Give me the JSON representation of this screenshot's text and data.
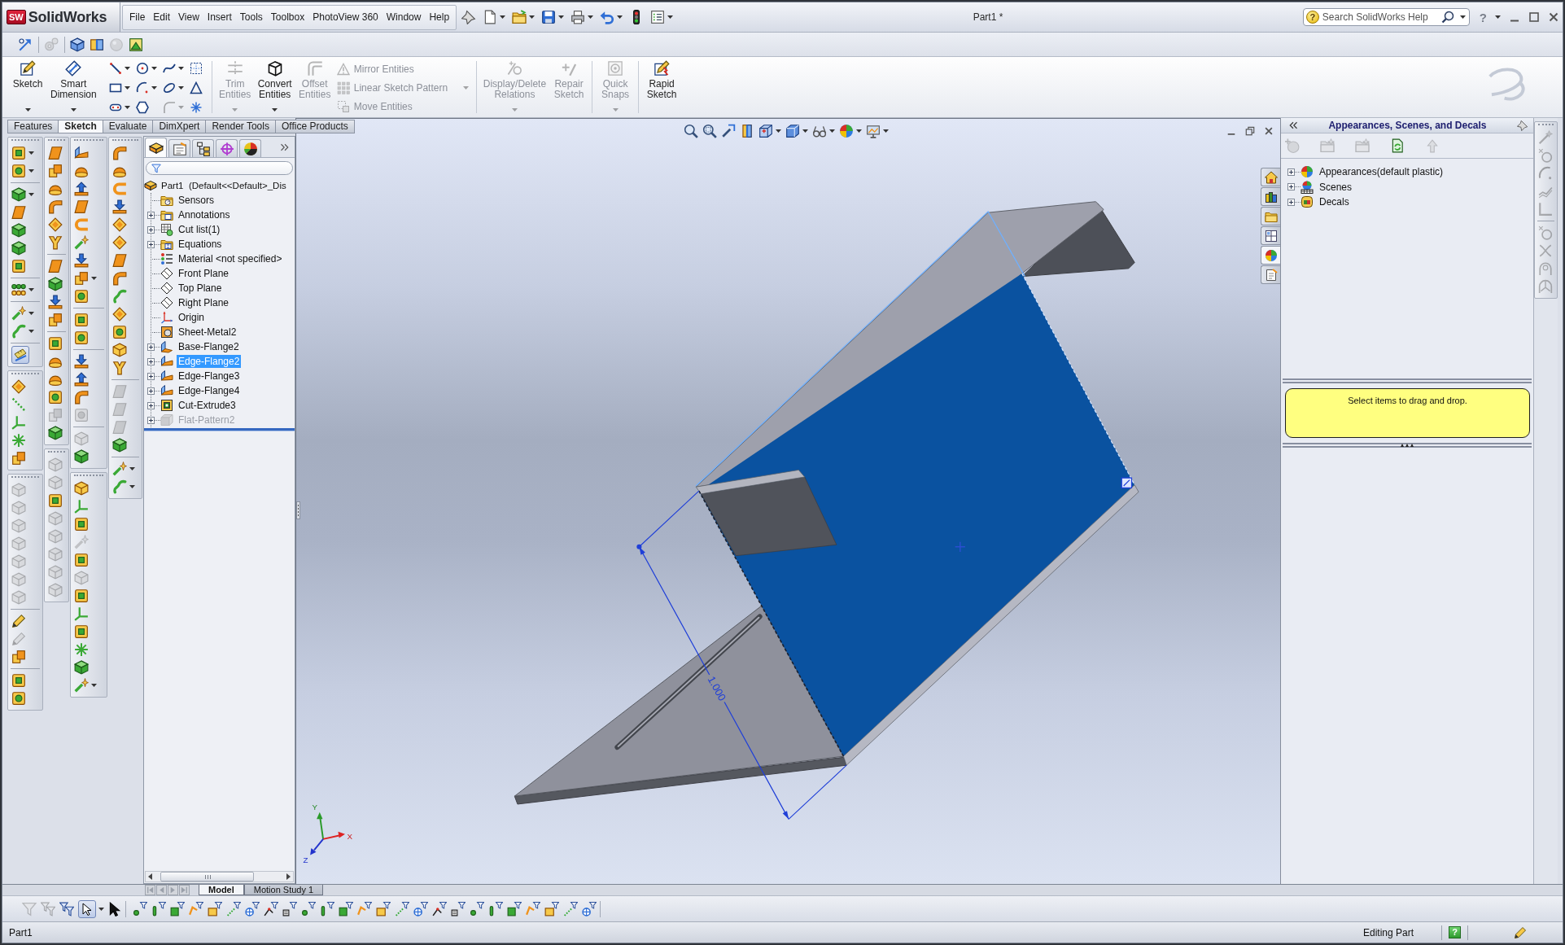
{
  "title_bar": {
    "logo_mark": "SW",
    "app_name": "SolidWorks",
    "menu": [
      "File",
      "Edit",
      "View",
      "Insert",
      "Tools",
      "Toolbox",
      "PhotoView 360",
      "Window",
      "Help"
    ],
    "quick_access": [
      {
        "kind": "pin",
        "dropdown": false
      },
      {
        "kind": "new",
        "dropdown": true
      },
      {
        "kind": "open",
        "dropdown": true
      },
      {
        "kind": "save",
        "dropdown": true
      },
      {
        "kind": "print",
        "dropdown": true
      },
      {
        "kind": "undo",
        "dropdown": true
      },
      {
        "kind": "rebuild",
        "dropdown": false
      },
      {
        "kind": "options",
        "dropdown": true
      }
    ],
    "document_title": "Part1 *",
    "search": {
      "badge": "?",
      "placeholder": "Search SolidWorks Help"
    },
    "help": "?"
  },
  "standard_toolbar": [
    [
      {
        "kind": "selectsketch",
        "disabled": false
      }
    ],
    [
      {
        "kind": "gears",
        "disabled": true
      }
    ],
    [
      {
        "kind": "bluecube",
        "disabled": false
      },
      {
        "kind": "section",
        "disabled": false
      },
      {
        "kind": "sphere",
        "disabled": true
      },
      {
        "kind": "scene",
        "disabled": false
      }
    ]
  ],
  "command_manager": [
    [
      {
        "kind": "large",
        "buttons": [
          {
            "kind": "sketch",
            "label": "Sketch",
            "disabled": false,
            "dropdown": true
          },
          {
            "kind": "smartdim",
            "label": "Smart Dimension",
            "disabled": false,
            "dropdown": true
          }
        ]
      },
      {
        "kind": "grid",
        "buttons": [
          {
            "kind": "sline",
            "disabled": false,
            "dropdown": true
          },
          {
            "kind": "scircle",
            "disabled": false,
            "dropdown": true
          },
          {
            "kind": "sspline",
            "disabled": false,
            "dropdown": true
          },
          {
            "kind": "sgrid",
            "disabled": false,
            "dropdown": false
          },
          {
            "kind": "srect",
            "disabled": false,
            "dropdown": true
          },
          {
            "kind": "sarc",
            "disabled": false,
            "dropdown": true
          },
          {
            "kind": "sellipse",
            "disabled": false,
            "dropdown": true
          },
          {
            "kind": "stext",
            "disabled": false,
            "dropdown": false
          },
          {
            "kind": "sslot",
            "disabled": false,
            "dropdown": true
          },
          {
            "kind": "spoly",
            "disabled": false,
            "dropdown": false
          },
          {
            "kind": "sfillet",
            "disabled": true,
            "dropdown": true
          },
          {
            "kind": "spoint",
            "disabled": false,
            "dropdown": false
          }
        ]
      }
    ],
    [
      {
        "kind": "large",
        "buttons": [
          {
            "kind": "trim",
            "label": "Trim Entities",
            "disabled": true,
            "dropdown": true
          },
          {
            "kind": "convert",
            "label": "Convert Entities",
            "disabled": false,
            "dropdown": true
          },
          {
            "kind": "offset",
            "label": "Offset Entities",
            "disabled": true,
            "dropdown": false
          }
        ]
      },
      {
        "kind": "list",
        "buttons": [
          {
            "kind": "mirror",
            "label": "Mirror Entities",
            "disabled": true,
            "dropdown": false
          },
          {
            "kind": "lpattern",
            "label": "Linear Sketch Pattern",
            "disabled": true,
            "dropdown": true
          },
          {
            "kind": "move",
            "label": "Move Entities",
            "disabled": true,
            "dropdown": false
          }
        ]
      }
    ],
    [
      {
        "kind": "large",
        "buttons": [
          {
            "kind": "relations",
            "label": "Display/Delete Relations",
            "disabled": true,
            "dropdown": true
          },
          {
            "kind": "repair",
            "label": "Repair Sketch",
            "disabled": true,
            "dropdown": false
          }
        ]
      }
    ],
    [
      {
        "kind": "large",
        "buttons": [
          {
            "kind": "snaps",
            "label": "Quick Snaps",
            "disabled": true,
            "dropdown": true
          }
        ]
      }
    ],
    [
      {
        "kind": "large",
        "buttons": [
          {
            "kind": "rapid",
            "label": "Rapid Sketch",
            "disabled": false,
            "dropdown": false
          }
        ]
      }
    ]
  ],
  "tabs": [
    {
      "label": "Features",
      "selected": false
    },
    {
      "label": "Sketch",
      "selected": true
    },
    {
      "label": "Evaluate",
      "selected": false
    },
    {
      "label": "DimXpert",
      "selected": false
    },
    {
      "label": "Render Tools",
      "selected": false
    },
    {
      "label": "Office Products",
      "selected": false
    }
  ],
  "left_toolbars": [
    [
      [
        [
          {
            "kind": "block",
            "disabled": false,
            "dropdown": true,
            "selected": false
          },
          {
            "kind": "ring",
            "disabled": false,
            "dropdown": true,
            "selected": false
          }
        ],
        [
          {
            "kind": "prism",
            "disabled": false,
            "dropdown": true,
            "selected": false
          },
          {
            "kind": "sheet",
            "disabled": false,
            "dropdown": false,
            "selected": false
          },
          {
            "kind": "prism",
            "disabled": false,
            "dropdown": false,
            "selected": false
          },
          {
            "kind": "prism",
            "disabled": false,
            "dropdown": false,
            "selected": false
          },
          {
            "kind": "block",
            "disabled": false,
            "dropdown": false,
            "selected": false
          }
        ],
        [
          {
            "kind": "dots",
            "disabled": false,
            "dropdown": true,
            "selected": false
          }
        ],
        [
          {
            "kind": "sparkle",
            "disabled": false,
            "dropdown": true,
            "selected": false
          },
          {
            "kind": "curve",
            "disabled": false,
            "dropdown": true,
            "selected": false
          }
        ],
        [
          {
            "kind": "ruler",
            "disabled": false,
            "dropdown": false,
            "selected": true
          }
        ]
      ],
      [
        [
          {
            "kind": "diamond",
            "disabled": false,
            "dropdown": false,
            "selected": false
          },
          {
            "kind": "line",
            "disabled": false,
            "dropdown": false,
            "selected": false
          },
          {
            "kind": "axes",
            "disabled": false,
            "dropdown": false,
            "selected": false
          },
          {
            "kind": "star",
            "disabled": false,
            "dropdown": false,
            "selected": false
          },
          {
            "kind": "stack",
            "disabled": false,
            "dropdown": false,
            "selected": false
          }
        ]
      ],
      [
        [
          {
            "kind": "cube",
            "disabled": true,
            "dropdown": false,
            "selected": false
          },
          {
            "kind": "cube",
            "disabled": true,
            "dropdown": false,
            "selected": false
          },
          {
            "kind": "cube",
            "disabled": true,
            "dropdown": false,
            "selected": false
          },
          {
            "kind": "cube",
            "disabled": true,
            "dropdown": false,
            "selected": false
          },
          {
            "kind": "cube",
            "disabled": true,
            "dropdown": false,
            "selected": false
          },
          {
            "kind": "cube",
            "disabled": true,
            "dropdown": false,
            "selected": false
          },
          {
            "kind": "cube",
            "disabled": true,
            "dropdown": false,
            "selected": false
          }
        ],
        [
          {
            "kind": "pencil",
            "disabled": false,
            "dropdown": false,
            "selected": false
          },
          {
            "kind": "pencil",
            "disabled": true,
            "dropdown": false,
            "selected": false
          },
          {
            "kind": "stack",
            "disabled": false,
            "dropdown": false,
            "selected": false
          }
        ],
        [
          {
            "kind": "block",
            "disabled": false,
            "dropdown": false,
            "selected": false
          },
          {
            "kind": "ring",
            "disabled": false,
            "dropdown": false,
            "selected": false
          }
        ]
      ]
    ],
    [
      [
        [
          {
            "kind": "sheet",
            "disabled": false,
            "dropdown": false,
            "selected": false
          },
          {
            "kind": "stack",
            "disabled": false,
            "dropdown": false,
            "selected": false
          },
          {
            "kind": "dome",
            "disabled": false,
            "dropdown": false,
            "selected": false
          },
          {
            "kind": "bend",
            "disabled": false,
            "dropdown": false,
            "selected": false
          },
          {
            "kind": "diamond",
            "disabled": false,
            "dropdown": false,
            "selected": false
          },
          {
            "kind": "fork",
            "disabled": false,
            "dropdown": false,
            "selected": false
          }
        ],
        [
          {
            "kind": "sheet",
            "disabled": false,
            "dropdown": false,
            "selected": false
          },
          {
            "kind": "prism",
            "disabled": false,
            "dropdown": false,
            "selected": false
          },
          {
            "kind": "arrowdown",
            "disabled": false,
            "dropdown": false,
            "selected": false
          },
          {
            "kind": "stack",
            "disabled": false,
            "dropdown": false,
            "selected": false
          }
        ],
        [
          {
            "kind": "block",
            "disabled": false,
            "dropdown": false,
            "selected": false
          },
          {
            "kind": "dome",
            "disabled": false,
            "dropdown": false,
            "selected": false
          },
          {
            "kind": "dome",
            "disabled": false,
            "dropdown": false,
            "selected": false
          },
          {
            "kind": "ring",
            "disabled": false,
            "dropdown": false,
            "selected": false
          },
          {
            "kind": "stack",
            "disabled": true,
            "dropdown": false,
            "selected": false
          },
          {
            "kind": "prism",
            "disabled": false,
            "dropdown": false,
            "selected": false
          }
        ]
      ],
      [
        [
          {
            "kind": "cube",
            "disabled": true,
            "dropdown": false,
            "selected": false
          },
          {
            "kind": "cube",
            "disabled": true,
            "dropdown": false,
            "selected": false
          },
          {
            "kind": "block",
            "disabled": false,
            "dropdown": false,
            "selected": false
          },
          {
            "kind": "cube",
            "disabled": true,
            "dropdown": false,
            "selected": false
          },
          {
            "kind": "cube",
            "disabled": true,
            "dropdown": false,
            "selected": false
          },
          {
            "kind": "cube",
            "disabled": true,
            "dropdown": false,
            "selected": false
          },
          {
            "kind": "cube",
            "disabled": true,
            "dropdown": false,
            "selected": false
          },
          {
            "kind": "cube",
            "disabled": true,
            "dropdown": false,
            "selected": false
          }
        ]
      ]
    ],
    [
      [
        [
          {
            "kind": "flange",
            "disabled": false,
            "dropdown": false,
            "selected": false
          },
          {
            "kind": "dome",
            "disabled": false,
            "dropdown": false,
            "selected": false
          },
          {
            "kind": "arrowup",
            "disabled": false,
            "dropdown": false,
            "selected": false
          },
          {
            "kind": "sheet",
            "disabled": false,
            "dropdown": false,
            "selected": false
          },
          {
            "kind": "hook",
            "disabled": false,
            "dropdown": false,
            "selected": false
          },
          {
            "kind": "sparkle",
            "disabled": false,
            "dropdown": false,
            "selected": false
          },
          {
            "kind": "arrowdown",
            "disabled": false,
            "dropdown": false,
            "selected": false
          },
          {
            "kind": "stack",
            "disabled": false,
            "dropdown": true,
            "selected": false
          },
          {
            "kind": "ring",
            "disabled": false,
            "dropdown": false,
            "selected": false
          }
        ],
        [
          {
            "kind": "block",
            "disabled": false,
            "dropdown": false,
            "selected": false
          },
          {
            "kind": "ring",
            "disabled": false,
            "dropdown": false,
            "selected": false
          }
        ],
        [
          {
            "kind": "arrowdown",
            "disabled": false,
            "dropdown": false,
            "selected": false
          },
          {
            "kind": "arrowup",
            "disabled": false,
            "dropdown": false,
            "selected": false
          },
          {
            "kind": "bend",
            "disabled": false,
            "dropdown": false,
            "selected": false
          },
          {
            "kind": "ring",
            "disabled": true,
            "dropdown": false,
            "selected": false
          }
        ],
        [
          {
            "kind": "cube",
            "disabled": true,
            "dropdown": false,
            "selected": false
          },
          {
            "kind": "prism",
            "disabled": false,
            "dropdown": false,
            "selected": false
          }
        ]
      ],
      [
        [
          {
            "kind": "cube",
            "disabled": false,
            "dropdown": false,
            "selected": false
          },
          {
            "kind": "axes",
            "disabled": false,
            "dropdown": false,
            "selected": false
          },
          {
            "kind": "block",
            "disabled": false,
            "dropdown": false,
            "selected": false
          },
          {
            "kind": "sparkle",
            "disabled": true,
            "dropdown": false,
            "selected": false
          },
          {
            "kind": "block",
            "disabled": false,
            "dropdown": false,
            "selected": false
          },
          {
            "kind": "cube",
            "disabled": true,
            "dropdown": false,
            "selected": false
          },
          {
            "kind": "block",
            "disabled": false,
            "dropdown": false,
            "selected": false
          },
          {
            "kind": "axes",
            "disabled": false,
            "dropdown": false,
            "selected": false
          },
          {
            "kind": "block",
            "disabled": false,
            "dropdown": false,
            "selected": false
          },
          {
            "kind": "star",
            "disabled": false,
            "dropdown": false,
            "selected": false
          },
          {
            "kind": "prism",
            "disabled": false,
            "dropdown": false,
            "selected": false
          },
          {
            "kind": "sparkle",
            "disabled": false,
            "dropdown": true,
            "selected": false
          }
        ]
      ]
    ],
    [
      [
        [
          {
            "kind": "bend",
            "disabled": false,
            "dropdown": false,
            "selected": false
          },
          {
            "kind": "dome",
            "disabled": false,
            "dropdown": false,
            "selected": false
          },
          {
            "kind": "hook",
            "disabled": false,
            "dropdown": false,
            "selected": false
          },
          {
            "kind": "arrowdown",
            "disabled": false,
            "dropdown": false,
            "selected": false
          },
          {
            "kind": "diamond",
            "disabled": false,
            "dropdown": false,
            "selected": false
          },
          {
            "kind": "diamond",
            "disabled": false,
            "dropdown": false,
            "selected": false
          },
          {
            "kind": "sheet",
            "disabled": false,
            "dropdown": false,
            "selected": false
          },
          {
            "kind": "bend",
            "disabled": false,
            "dropdown": false,
            "selected": false
          },
          {
            "kind": "curve",
            "disabled": false,
            "dropdown": false,
            "selected": false
          },
          {
            "kind": "diamond",
            "disabled": false,
            "dropdown": false,
            "selected": false
          },
          {
            "kind": "ring",
            "disabled": false,
            "dropdown": false,
            "selected": false
          },
          {
            "kind": "cube",
            "disabled": false,
            "dropdown": false,
            "selected": false
          },
          {
            "kind": "fork",
            "disabled": false,
            "dropdown": false,
            "selected": false
          }
        ],
        [
          {
            "kind": "sheet",
            "disabled": true,
            "dropdown": false,
            "selected": false
          },
          {
            "kind": "sheet",
            "disabled": true,
            "dropdown": false,
            "selected": false
          },
          {
            "kind": "sheet",
            "disabled": true,
            "dropdown": false,
            "selected": false
          },
          {
            "kind": "prism",
            "disabled": false,
            "dropdown": false,
            "selected": false
          }
        ],
        [
          {
            "kind": "sparkle",
            "disabled": false,
            "dropdown": true,
            "selected": false
          },
          {
            "kind": "curve",
            "disabled": false,
            "dropdown": true,
            "selected": false
          }
        ]
      ]
    ]
  ],
  "feature_manager": {
    "tabs": [
      {
        "kind": "tree",
        "selected": true
      },
      {
        "kind": "property",
        "selected": false
      },
      {
        "kind": "config",
        "selected": false
      },
      {
        "kind": "dimxpert",
        "selected": false
      },
      {
        "kind": "display",
        "selected": false
      }
    ],
    "tree": {
      "label": "Part1  (Default<<Default>_Dis",
      "kind": "part",
      "children": [
        {
          "label": "Sensors",
          "kind": "sensors",
          "expandable": false,
          "selected": false,
          "disabled": false
        },
        {
          "label": "Annotations",
          "kind": "annotations",
          "expandable": true,
          "selected": false,
          "disabled": false
        },
        {
          "label": "Cut list(1)",
          "kind": "cutlist",
          "expandable": true,
          "selected": false,
          "disabled": false
        },
        {
          "label": "Equations",
          "kind": "equations",
          "expandable": true,
          "selected": false,
          "disabled": false
        },
        {
          "label": "Material <not specified>",
          "kind": "material",
          "expandable": false,
          "selected": false,
          "disabled": false
        },
        {
          "label": "Front Plane",
          "kind": "plane",
          "expandable": false,
          "selected": false,
          "disabled": false
        },
        {
          "label": "Top Plane",
          "kind": "plane",
          "expandable": false,
          "selected": false,
          "disabled": false
        },
        {
          "label": "Right Plane",
          "kind": "plane",
          "expandable": false,
          "selected": false,
          "disabled": false
        },
        {
          "label": "Origin",
          "kind": "origin",
          "expandable": false,
          "selected": false,
          "disabled": false
        },
        {
          "label": "Sheet-Metal2",
          "kind": "sheetmetal",
          "expandable": false,
          "selected": false,
          "disabled": false
        },
        {
          "label": "Base-Flange2",
          "kind": "baseflange",
          "expandable": true,
          "selected": false,
          "disabled": false
        },
        {
          "label": "Edge-Flange2",
          "kind": "flange",
          "expandable": true,
          "selected": true,
          "disabled": false
        },
        {
          "label": "Edge-Flange3",
          "kind": "flange",
          "expandable": true,
          "selected": false,
          "disabled": false
        },
        {
          "label": "Edge-Flange4",
          "kind": "flange",
          "expandable": true,
          "selected": false,
          "disabled": false
        },
        {
          "label": "Cut-Extrude3",
          "kind": "cutextrude",
          "expandable": true,
          "selected": false,
          "disabled": false
        },
        {
          "label": "Flat-Pattern2",
          "kind": "flatpattern",
          "expandable": true,
          "selected": false,
          "disabled": true
        }
      ]
    }
  },
  "viewport": {
    "heads_up_toolbar": [
      {
        "kind": "zoomfit",
        "dropdown": false
      },
      {
        "kind": "zoomarea",
        "dropdown": false
      },
      {
        "kind": "prevview",
        "dropdown": false
      },
      {
        "kind": "sectionview",
        "dropdown": false
      },
      {
        "kind": "orientation",
        "dropdown": true
      },
      {
        "kind": "displaystyle",
        "dropdown": true
      },
      {
        "kind": "hideshow",
        "dropdown": true
      },
      {
        "kind": "appearance",
        "dropdown": true
      },
      {
        "kind": "scenemenu",
        "dropdown": true
      }
    ],
    "dimension": "1.000",
    "triad": {
      "x": "X",
      "y": "Y",
      "z": "Z"
    }
  },
  "task_pane": {
    "tabs": [
      {
        "kind": "home",
        "selected": false
      },
      {
        "kind": "library",
        "selected": false
      },
      {
        "kind": "explorer",
        "selected": false
      },
      {
        "kind": "palette",
        "selected": false
      },
      {
        "kind": "appearances",
        "selected": true
      },
      {
        "kind": "properties",
        "selected": false
      }
    ],
    "title": "Appearances, Scenes, and Decals",
    "toolbar": [
      {
        "kind": "add",
        "disabled": true
      },
      {
        "kind": "newfolder",
        "disabled": true
      },
      {
        "kind": "newfolder",
        "disabled": true
      },
      {
        "kind": "refresh",
        "disabled": false
      },
      {
        "kind": "up",
        "disabled": true
      }
    ],
    "tree": [
      {
        "label": "Appearances(default plastic)",
        "kind": "appearances",
        "expandable": true
      },
      {
        "label": "Scenes",
        "kind": "scenes",
        "expandable": true
      },
      {
        "label": "Decals",
        "kind": "decals",
        "expandable": true
      }
    ],
    "hint": "Select items to drag and drop."
  },
  "sketch_toolbar": [
    [
      {
        "kind": "wand",
        "disabled": true
      },
      {
        "kind": "circletip",
        "disabled": true
      },
      {
        "kind": "sarc",
        "disabled": true
      },
      {
        "kind": "zigzag",
        "disabled": true
      },
      {
        "kind": "corner",
        "disabled": true
      }
    ],
    [
      {
        "kind": "circletip",
        "disabled": true
      },
      {
        "kind": "trimx",
        "disabled": true
      },
      {
        "kind": "arch",
        "disabled": true
      },
      {
        "kind": "wheel",
        "disabled": true
      }
    ]
  ],
  "bottom_tabs": [
    {
      "label": "Model",
      "selected": true
    },
    {
      "label": "Motion Study 1",
      "selected": false
    }
  ],
  "selection_filter": [
    [
      {
        "kind": "funnel",
        "disabled": true,
        "selected": false,
        "dropdown": false
      },
      {
        "kind": "funnels",
        "disabled": true,
        "selected": false,
        "dropdown": false
      },
      {
        "kind": "funnels",
        "disabled": false,
        "selected": false,
        "dropdown": false
      },
      {
        "kind": "select",
        "disabled": false,
        "selected": true,
        "dropdown": true
      },
      {
        "kind": "arrow",
        "disabled": false,
        "selected": false,
        "dropdown": false
      }
    ],
    [
      {
        "kind": "shapefilter",
        "disabled": false,
        "selected": false,
        "dropdown": false
      },
      {
        "kind": "shapefilter",
        "disabled": false,
        "selected": false,
        "dropdown": false
      },
      {
        "kind": "shapefilter",
        "disabled": false,
        "selected": false,
        "dropdown": false
      },
      {
        "kind": "shapefilter",
        "disabled": false,
        "selected": false,
        "dropdown": false
      },
      {
        "kind": "shapefilter",
        "disabled": false,
        "selected": false,
        "dropdown": false
      },
      {
        "kind": "shapefilter",
        "disabled": false,
        "selected": false,
        "dropdown": false
      },
      {
        "kind": "shapefilter",
        "disabled": false,
        "selected": false,
        "dropdown": false
      },
      {
        "kind": "shapefilter",
        "disabled": false,
        "selected": false,
        "dropdown": false
      },
      {
        "kind": "shapefilter",
        "disabled": false,
        "selected": false,
        "dropdown": false
      },
      {
        "kind": "shapefilter",
        "disabled": false,
        "selected": false,
        "dropdown": false
      },
      {
        "kind": "shapefilter",
        "disabled": false,
        "selected": false,
        "dropdown": false
      },
      {
        "kind": "shapefilter",
        "disabled": false,
        "selected": false,
        "dropdown": false
      },
      {
        "kind": "shapefilter",
        "disabled": false,
        "selected": false,
        "dropdown": false
      },
      {
        "kind": "shapefilter",
        "disabled": false,
        "selected": false,
        "dropdown": false
      },
      {
        "kind": "shapefilter",
        "disabled": false,
        "selected": false,
        "dropdown": false
      },
      {
        "kind": "shapefilter",
        "disabled": false,
        "selected": false,
        "dropdown": false
      },
      {
        "kind": "shapefilter",
        "disabled": false,
        "selected": false,
        "dropdown": false
      },
      {
        "kind": "shapefilter",
        "disabled": false,
        "selected": false,
        "dropdown": false
      },
      {
        "kind": "shapefilter",
        "disabled": false,
        "selected": false,
        "dropdown": false
      },
      {
        "kind": "shapefilter",
        "disabled": false,
        "selected": false,
        "dropdown": false
      },
      {
        "kind": "shapefilter",
        "disabled": false,
        "selected": false,
        "dropdown": false
      },
      {
        "kind": "shapefilter",
        "disabled": false,
        "selected": false,
        "dropdown": false
      },
      {
        "kind": "shapefilter",
        "disabled": false,
        "selected": false,
        "dropdown": false
      },
      {
        "kind": "shapefilter",
        "disabled": false,
        "selected": false,
        "dropdown": false
      },
      {
        "kind": "shapefilter",
        "disabled": false,
        "selected": false,
        "dropdown": false
      }
    ]
  ],
  "status_bar": {
    "document": "Part1",
    "mode": "Editing Part",
    "help": "?"
  }
}
